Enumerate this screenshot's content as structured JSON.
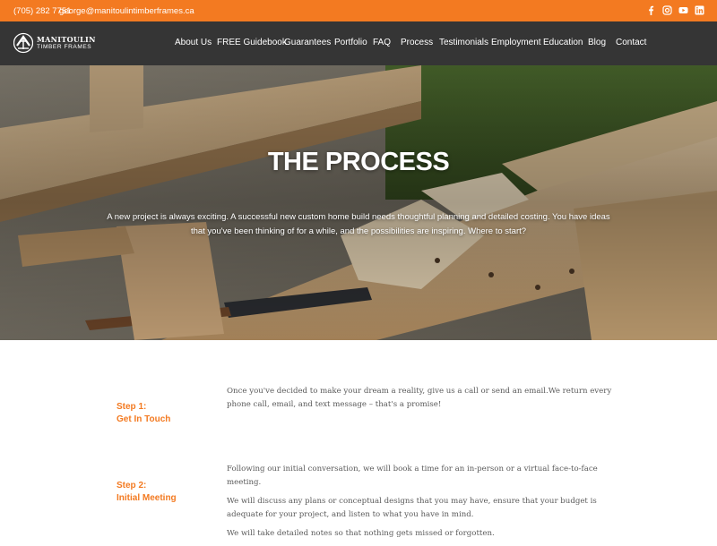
{
  "topbar": {
    "phone": "(705) 282 7751",
    "email": "george@manitoulintimberframes.ca",
    "accent_color": "#f37a21",
    "social": [
      {
        "name": "facebook-icon",
        "glyph": "f"
      },
      {
        "name": "instagram-icon",
        "glyph": "◎"
      },
      {
        "name": "youtube-icon",
        "glyph": "▶"
      },
      {
        "name": "linkedin-icon",
        "glyph": "in"
      }
    ]
  },
  "brand": {
    "name": "MANITOULIN",
    "sub": "TIMBER FRAMES",
    "icon": "timber-frame-logo-icon"
  },
  "nav": {
    "items": [
      {
        "label": "About Us"
      },
      {
        "label": "FREE Guidebook"
      },
      {
        "label": "Guarantees"
      },
      {
        "label": "Portfolio"
      },
      {
        "label": "FAQ"
      },
      {
        "label": "Process"
      },
      {
        "label": "Testimonials"
      },
      {
        "label": "Employment"
      },
      {
        "label": "Education"
      },
      {
        "label": "Blog"
      },
      {
        "label": "Contact"
      }
    ],
    "background": "#353535"
  },
  "hero": {
    "title": "THE PROCESS",
    "intro": "A new project is always exciting. A successful new custom home build needs thoughtful planning and detailed costing. You have ideas that you've been thinking of for a while, and the possibilities are inspiring. Where to start?"
  },
  "steps": [
    {
      "number": "Step 1:",
      "title": "Get In Touch",
      "paragraphs": [
        "Once you've decided to make your dream a reality, give us a call or send an email.We return every phone call, email, and text message – that's a promise!"
      ]
    },
    {
      "number": "Step 2:",
      "title": "Initial Meeting",
      "paragraphs": [
        "Following our initial conversation, we will book a time for an in-person or a virtual face-to-face meeting.",
        "We will discuss any plans or conceptual designs that you may have, ensure that your budget is adequate for your project, and listen to what you have in mind.",
        "We will take detailed notes so that nothing gets missed or forgotten."
      ]
    }
  ]
}
